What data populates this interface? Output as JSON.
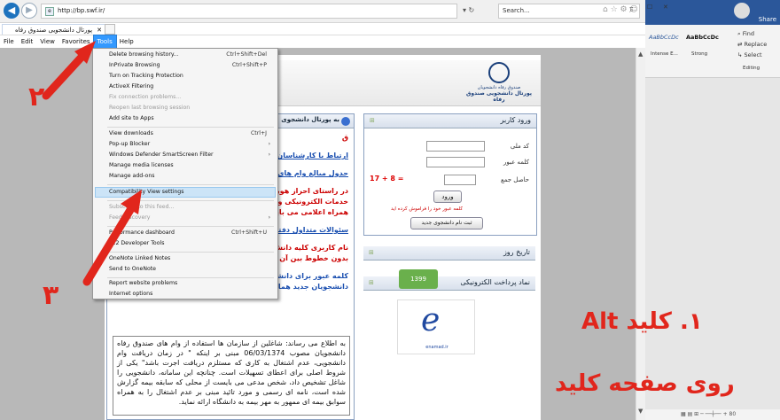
{
  "browser": {
    "url": "http://bp.swf.ir/",
    "search_placeholder": "Search...",
    "tab_title": "پورتال دانشجویی صندوق رفاه",
    "menu": [
      "File",
      "Edit",
      "View",
      "Favorites",
      "Tools",
      "Help"
    ],
    "window_controls": [
      "–",
      "☐",
      "✕"
    ]
  },
  "tools_menu": {
    "items": [
      {
        "label": "Delete browsing history...",
        "shortcut": "Ctrl+Shift+Del"
      },
      {
        "label": "InPrivate Browsing",
        "shortcut": "Ctrl+Shift+P"
      },
      {
        "label": "Turn on Tracking Protection",
        "shortcut": ""
      },
      {
        "label": "ActiveX Filtering",
        "shortcut": ""
      },
      {
        "label": "Fix connection problems...",
        "shortcut": ""
      },
      {
        "label": "Reopen last browsing session",
        "shortcut": ""
      },
      {
        "label": "Add site to Apps",
        "shortcut": ""
      },
      {
        "label": "View downloads",
        "shortcut": "Ctrl+J"
      },
      {
        "label": "Pop-up Blocker",
        "shortcut": ""
      },
      {
        "label": "Windows Defender SmartScreen Filter",
        "shortcut": ""
      },
      {
        "label": "Manage media licenses",
        "shortcut": ""
      },
      {
        "label": "Manage add-ons",
        "shortcut": ""
      },
      {
        "label": "Compatibility View settings",
        "shortcut": ""
      },
      {
        "label": "Subscribe to this feed...",
        "shortcut": ""
      },
      {
        "label": "Feed discovery",
        "shortcut": ""
      },
      {
        "label": "Performance dashboard",
        "shortcut": "Ctrl+Shift+U"
      },
      {
        "label": "F12 Developer Tools",
        "shortcut": ""
      },
      {
        "label": "OneNote Linked Notes",
        "shortcut": ""
      },
      {
        "label": "Send to OneNote",
        "shortcut": ""
      },
      {
        "label": "Report website problems",
        "shortcut": ""
      },
      {
        "label": "Internet options",
        "shortcut": ""
      }
    ]
  },
  "site": {
    "logo_line1": "صندوق رفاه دانشجویان",
    "logo_line2": "پورتال دانشجویی صندوق رفاه",
    "news_title": "به پورتال دانشجوی",
    "news_lines": [
      "ق",
      "ارتباط با کارشناسان و",
      "جدول مبالغ وام های د",
      "در راستای احراز هویت",
      "خدمات الکترونیکی و",
      "همراه اعلامی می باید",
      "سئوالات متداول دفترچ",
      "نام کاربری کلیه دانش",
      "بدون خطوط بین آن ها",
      "کلمه عبور برای دانشج",
      "دانشجویان جدید همان"
    ],
    "notice": "به اطلاع می رساند: شاغلین از سازمان ها استفاده از وام های صندوق رفاه دانشجویان مصوب 06/03/1374 مبنی بر اینکه \" در زمان دریافت وام دانشجویی، عدم اشتغال به کاری که مستلزم دریافت اجرت باشد\" یکی از شروط اصلی برای اعطای تسهیلات است. چنانچه این سامانه، دانشجویی را شاغل تشخیص داد، شخص مدعی می بایست از محلی که سابقه بیمه گزارش شده است، نامه ای رسمی و مورد تائید مبنی بر عدم اشتغال را به همراه سوابق بیمه ای ممهور به مهر بیمه به دانشگاه ارائه نماید.",
    "login_title": "ورود کاربر",
    "national_code_label": "کد ملی",
    "password_label": "کلمه عبور",
    "sum_label": "حاصل جمع",
    "captcha": "17 + 8 =",
    "login_button": "ورود",
    "forgot_link": "کلمه عبور خود را فراموش کرده اید",
    "register_button": "ثبت نام دانشجوی جدید",
    "history_title": "تاریخ روز",
    "payment_title": "نماد پرداخت الکترونیکی",
    "payment_year": "1399",
    "enamad_text": "enamad.ir"
  },
  "word": {
    "share": "Share",
    "styles": [
      "AaBbCcDc",
      "AaBbCcDc"
    ],
    "style_labels": [
      "Intense E...",
      "Strong"
    ],
    "editing": [
      "Find",
      "Replace",
      "Select",
      "Editing"
    ],
    "zoom": "80"
  },
  "annotations": {
    "num2": "٢",
    "num3": "٣",
    "step1_line1": "١. کلید Alt",
    "step1_line2": "روی صفحه کلید",
    "color": "#e1261c"
  }
}
